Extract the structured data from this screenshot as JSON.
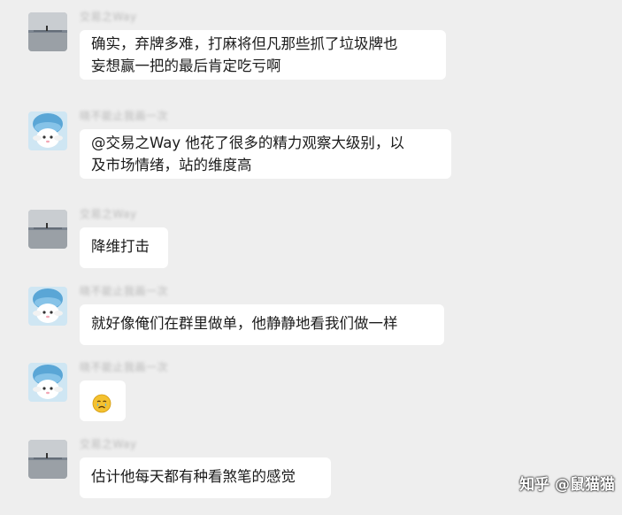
{
  "messages": [
    {
      "sender": "交易之Way",
      "avatar": "beach-avatar",
      "lines": [
        "确实，弃牌多难，打麻将但凡那些抓了垃圾牌也",
        "妄想赢一把的最后肯定吃亏啊"
      ]
    },
    {
      "sender": "晓不能止我画一次",
      "avatar": "bunny-avatar",
      "lines": [
        "@交易之Way 他花了很多的精力观察大级别，以",
        "及市场情绪，站的维度高"
      ]
    },
    {
      "sender": "交易之Way",
      "avatar": "beach-avatar",
      "lines": [
        "降维打击"
      ]
    },
    {
      "sender": "晓不能止我画一次",
      "avatar": "bunny-avatar",
      "lines": [
        "就好像俺们在群里做单，他静静地看我们做一样"
      ]
    },
    {
      "sender": "晓不能止我画一次",
      "avatar": "bunny-avatar",
      "emoji": "crying-face-icon",
      "lines": []
    },
    {
      "sender": "交易之Way",
      "avatar": "beach-avatar",
      "lines": [
        "估计他每天都有种看煞笔的感觉"
      ]
    }
  ],
  "watermark": "知乎 @鼠猫猫",
  "colors": {
    "background": "#eeeeee",
    "bubble": "#ffffff",
    "text": "#1b1b1b"
  }
}
